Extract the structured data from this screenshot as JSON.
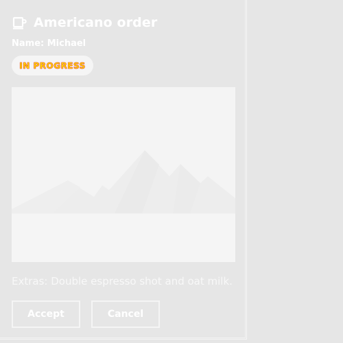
{
  "card": {
    "title": "Americano order",
    "icon": "coffee-cup-icon",
    "name_line": "Name: Michael",
    "status_badge": "IN PROGRESS",
    "image": {
      "icon": "image-placeholder-icon"
    },
    "extras_text": "Extras: Double espresso shot and oat milk.",
    "buttons": {
      "accept_label": "Accept",
      "cancel_label": "Cancel"
    }
  },
  "colors": {
    "background": "#e6e6e6",
    "text": "#ffffff",
    "badge_bg": "#f5f5f5",
    "badge_text": "#ffd800",
    "badge_text_outline": "#e01010",
    "image_bg": "#f4f4f4"
  }
}
